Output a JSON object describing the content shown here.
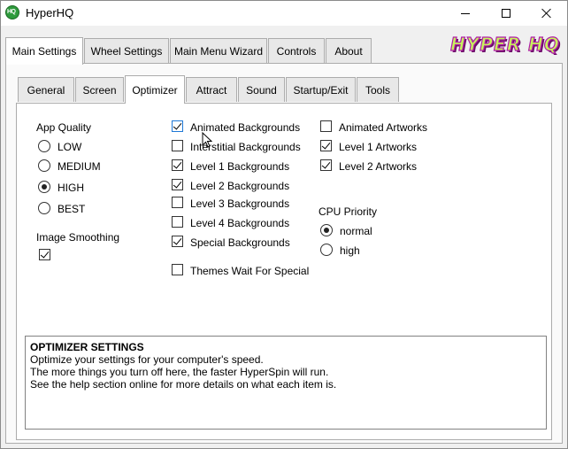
{
  "window": {
    "title": "HyperHQ"
  },
  "main_tabs": [
    "Main Settings",
    "Wheel Settings",
    "Main Menu Wizard",
    "Controls",
    "About"
  ],
  "main_tab_active": "Main Settings",
  "logo_text": "HYPER HQ",
  "sub_tabs": [
    "General",
    "Screen",
    "Optimizer",
    "Attract",
    "Sound",
    "Startup/Exit",
    "Tools"
  ],
  "sub_tab_active": "Optimizer",
  "app_quality": {
    "label": "App Quality",
    "options": [
      "LOW",
      "MEDIUM",
      "HIGH",
      "BEST"
    ],
    "selected": "HIGH"
  },
  "image_smoothing": {
    "label": "Image Smoothing",
    "checked": true
  },
  "backgrounds": [
    {
      "label": "Animated Backgrounds",
      "checked": true
    },
    {
      "label": "Interstitial Backgrounds",
      "checked": false
    },
    {
      "label": "Level 1 Backgrounds",
      "checked": true
    },
    {
      "label": "Level 2 Backgrounds",
      "checked": true
    },
    {
      "label": "Level 3 Backgrounds",
      "checked": false
    },
    {
      "label": "Level 4 Backgrounds",
      "checked": false
    },
    {
      "label": "Special Backgrounds",
      "checked": true
    }
  ],
  "themes_wait": {
    "label": "Themes Wait For Special",
    "checked": false
  },
  "artworks": [
    {
      "label": "Animated Artworks",
      "checked": false
    },
    {
      "label": "Level 1 Artworks",
      "checked": true
    },
    {
      "label": "Level 2 Artworks",
      "checked": true
    }
  ],
  "cpu_priority": {
    "label": "CPU Priority",
    "options": [
      "normal",
      "high"
    ],
    "selected": "normal"
  },
  "info": {
    "title": "OPTIMIZER SETTINGS",
    "lines": [
      "Optimize your settings for your computer's speed.",
      "The more things you turn off here, the faster HyperSpin will run.",
      "See the help section online for more details on what each item is."
    ]
  }
}
